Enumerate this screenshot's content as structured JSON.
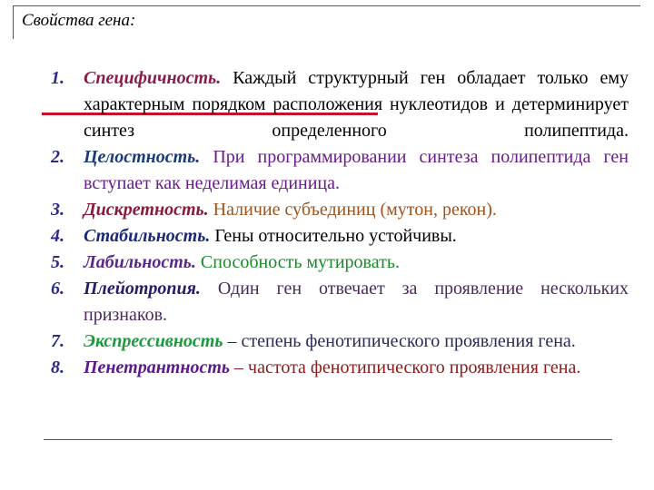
{
  "title": "Свойства гена:",
  "colors": {
    "number": "#2a2a8a",
    "red_underline": "#c8102e"
  },
  "properties": [
    {
      "num": "1.",
      "term": "Специфичность.",
      "desc": " Каждый структурный ген обладает только ему характерным порядком расположения нуклеотидов и детерминирует синтез определенного полипептида.",
      "term_color": "#8b1a4a",
      "desc_color": "#000000"
    },
    {
      "num": "2.",
      "term": "Целостность.",
      "desc": " При программировании синтеза полипептида ген вступает как неделимая единица.",
      "term_color": "#1a3a7a",
      "desc_color": "#6a1a8a"
    },
    {
      "num": "3.",
      "term": "Дискретность.",
      "desc": " Наличие субъединиц (мутон, рекон).",
      "term_color": "#8b1a3a",
      "desc_color": "#a0521a"
    },
    {
      "num": "4.",
      "term": "Стабильность.",
      "desc": " Гены относительно устойчивы.",
      "term_color": "#1a2a7a",
      "desc_color": "#000000"
    },
    {
      "num": "5.",
      "term": "Лабильность.",
      "desc": " Способность мутировать.",
      "term_color": "#5a2a8a",
      "desc_color": "#1a8a2a"
    },
    {
      "num": "6.",
      "term": "Плейотропия.",
      "desc": " Один ген отвечает за проявление нескольких признаков.",
      "term_color": "#2a1a6a",
      "desc_color": "#4a2a5a"
    },
    {
      "num": "7.",
      "term": "Экспрессивность",
      "desc": " – степень фенотипического проявления гена.",
      "term_color": "#1a9a3a",
      "desc_color": "#2a2a5a"
    },
    {
      "num": "8.",
      "term": "Пенетрантность",
      "desc": " – частота фенотипического проявления гена.",
      "term_color": "#5a1a8a",
      "desc_color": "#8b1a1a"
    }
  ]
}
